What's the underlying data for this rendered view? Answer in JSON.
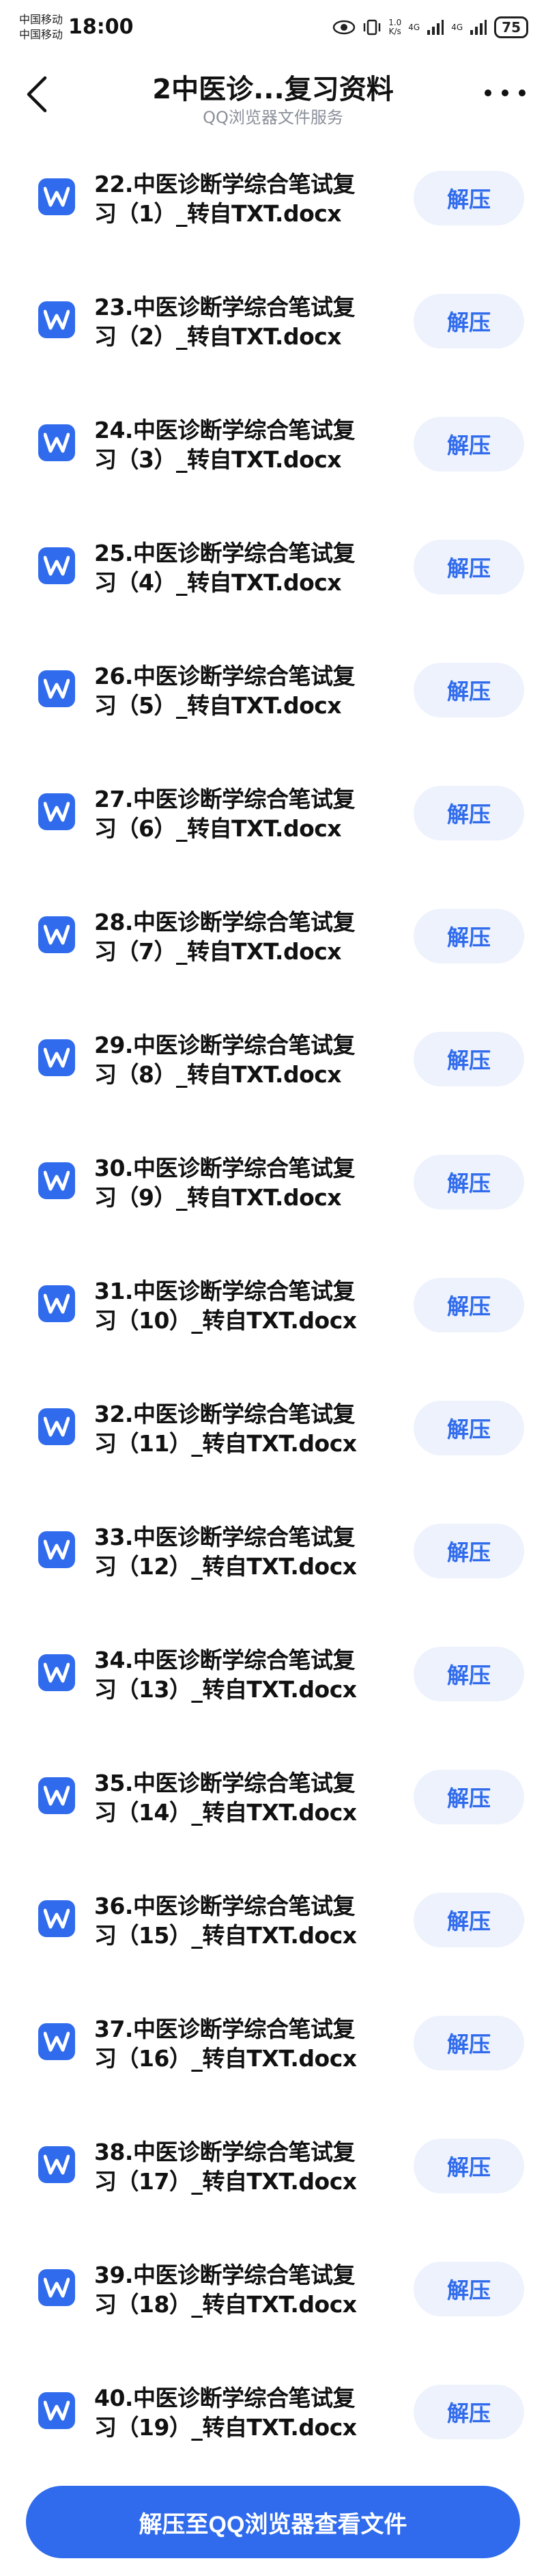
{
  "status_bar": {
    "carrier_1": "中国移动",
    "carrier_2": "中国移动",
    "time": "18:00",
    "net_speed_top": "1.0",
    "net_speed_bottom": "K/s",
    "signal_1": "4G",
    "signal_2": "4G",
    "battery": "75"
  },
  "header": {
    "title": "2中医诊...复习资料",
    "subtitle": "QQ浏览器文件服务"
  },
  "file_icon": "word-icon",
  "unzip_label": "解压",
  "files": [
    {
      "line1": "22.中医诊断学综合笔试复",
      "line2": "习（1）_转自TXT.docx"
    },
    {
      "line1": "23.中医诊断学综合笔试复",
      "line2": "习（2）_转自TXT.docx"
    },
    {
      "line1": "24.中医诊断学综合笔试复",
      "line2": "习（3）_转自TXT.docx"
    },
    {
      "line1": "25.中医诊断学综合笔试复",
      "line2": "习（4）_转自TXT.docx"
    },
    {
      "line1": "26.中医诊断学综合笔试复",
      "line2": "习（5）_转自TXT.docx"
    },
    {
      "line1": "27.中医诊断学综合笔试复",
      "line2": "习（6）_转自TXT.docx"
    },
    {
      "line1": "28.中医诊断学综合笔试复",
      "line2": "习（7）_转自TXT.docx"
    },
    {
      "line1": "29.中医诊断学综合笔试复",
      "line2": "习（8）_转自TXT.docx"
    },
    {
      "line1": "30.中医诊断学综合笔试复",
      "line2": "习（9）_转自TXT.docx"
    },
    {
      "line1": "31.中医诊断学综合笔试复",
      "line2": "习（10）_转自TXT.docx"
    },
    {
      "line1": "32.中医诊断学综合笔试复",
      "line2": "习（11）_转自TXT.docx"
    },
    {
      "line1": "33.中医诊断学综合笔试复",
      "line2": "习（12）_转自TXT.docx"
    },
    {
      "line1": "34.中医诊断学综合笔试复",
      "line2": "习（13）_转自TXT.docx"
    },
    {
      "line1": "35.中医诊断学综合笔试复",
      "line2": "习（14）_转自TXT.docx"
    },
    {
      "line1": "36.中医诊断学综合笔试复",
      "line2": "习（15）_转自TXT.docx"
    },
    {
      "line1": "37.中医诊断学综合笔试复",
      "line2": "习（16）_转自TXT.docx"
    },
    {
      "line1": "38.中医诊断学综合笔试复",
      "line2": "习（17）_转自TXT.docx"
    },
    {
      "line1": "39.中医诊断学综合笔试复",
      "line2": "习（18）_转自TXT.docx"
    },
    {
      "line1": "40.中医诊断学综合笔试复",
      "line2": "习（19）_转自TXT.docx"
    }
  ],
  "bottom_button": "解压至QQ浏览器查看文件",
  "colors": {
    "accent": "#2f6bec",
    "button_bg": "#eef2fd",
    "subtitle": "#8a8f99"
  }
}
